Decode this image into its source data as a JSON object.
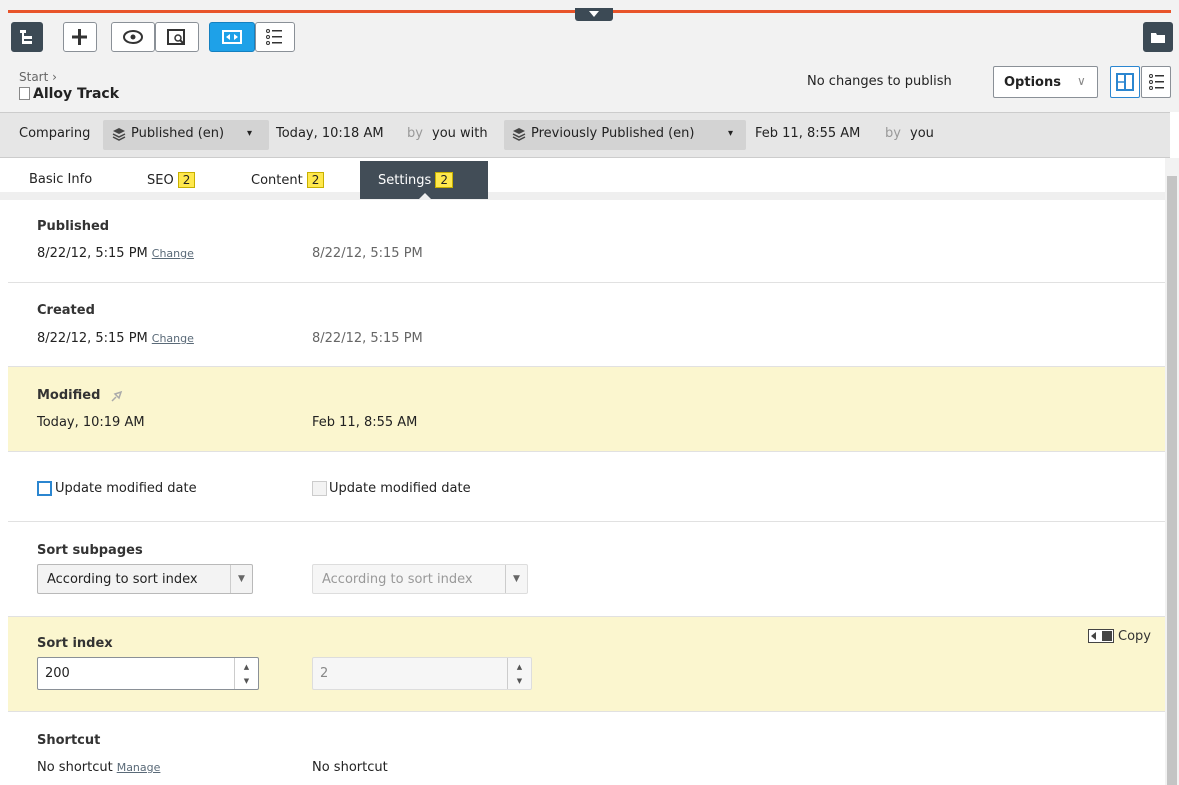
{
  "toolbar": {
    "buttons": [
      "tree-icon",
      "add-icon",
      "preview-icon",
      "view-on-site-icon",
      "compare-icon",
      "list-icon"
    ]
  },
  "header": {
    "breadcrumb": "Start",
    "breadcrumb_sep": "›",
    "title": "Alloy Track",
    "status": "No changes to publish",
    "options_label": "Options",
    "options_chevron": "∨"
  },
  "compare": {
    "label": "Comparing",
    "left_version": "Published (en)",
    "left_time": "Today, 10:18 AM",
    "by1": "by",
    "user1": "you with",
    "right_version": "Previously Published (en)",
    "right_time": "Feb 11, 8:55 AM",
    "by2": "by",
    "user2": "you",
    "dd_arrow": "▾"
  },
  "tabs": [
    {
      "label": "Basic Info",
      "badge": ""
    },
    {
      "label": "SEO",
      "badge": "2"
    },
    {
      "label": "Content",
      "badge": "2"
    },
    {
      "label": "Settings",
      "badge": "2"
    }
  ],
  "fields": {
    "published": {
      "label": "Published",
      "current": "8/22/12, 5:15 PM",
      "action": "Change",
      "previous": "8/22/12, 5:15 PM"
    },
    "created": {
      "label": "Created",
      "current": "8/22/12, 5:15 PM",
      "action": "Change",
      "previous": "8/22/12, 5:15 PM"
    },
    "modified": {
      "label": "Modified",
      "current": "Today, 10:19 AM",
      "previous": "Feb 11, 8:55 AM"
    },
    "update_modified": {
      "current": "Update modified date",
      "previous": "Update modified date"
    },
    "sort_subpages": {
      "label": "Sort subpages",
      "current": "According to sort index",
      "previous": "According to sort index"
    },
    "sort_index": {
      "label": "Sort index",
      "current": "200",
      "previous": "2",
      "copy_label": "Copy"
    },
    "shortcut": {
      "label": "Shortcut",
      "current": "No shortcut",
      "action": "Manage",
      "previous": "No shortcut"
    }
  },
  "colors": {
    "accent": "#e8542a",
    "highlight": "#fbf6cf",
    "badge": "#ffe84d",
    "active_tab": "#424d57"
  }
}
